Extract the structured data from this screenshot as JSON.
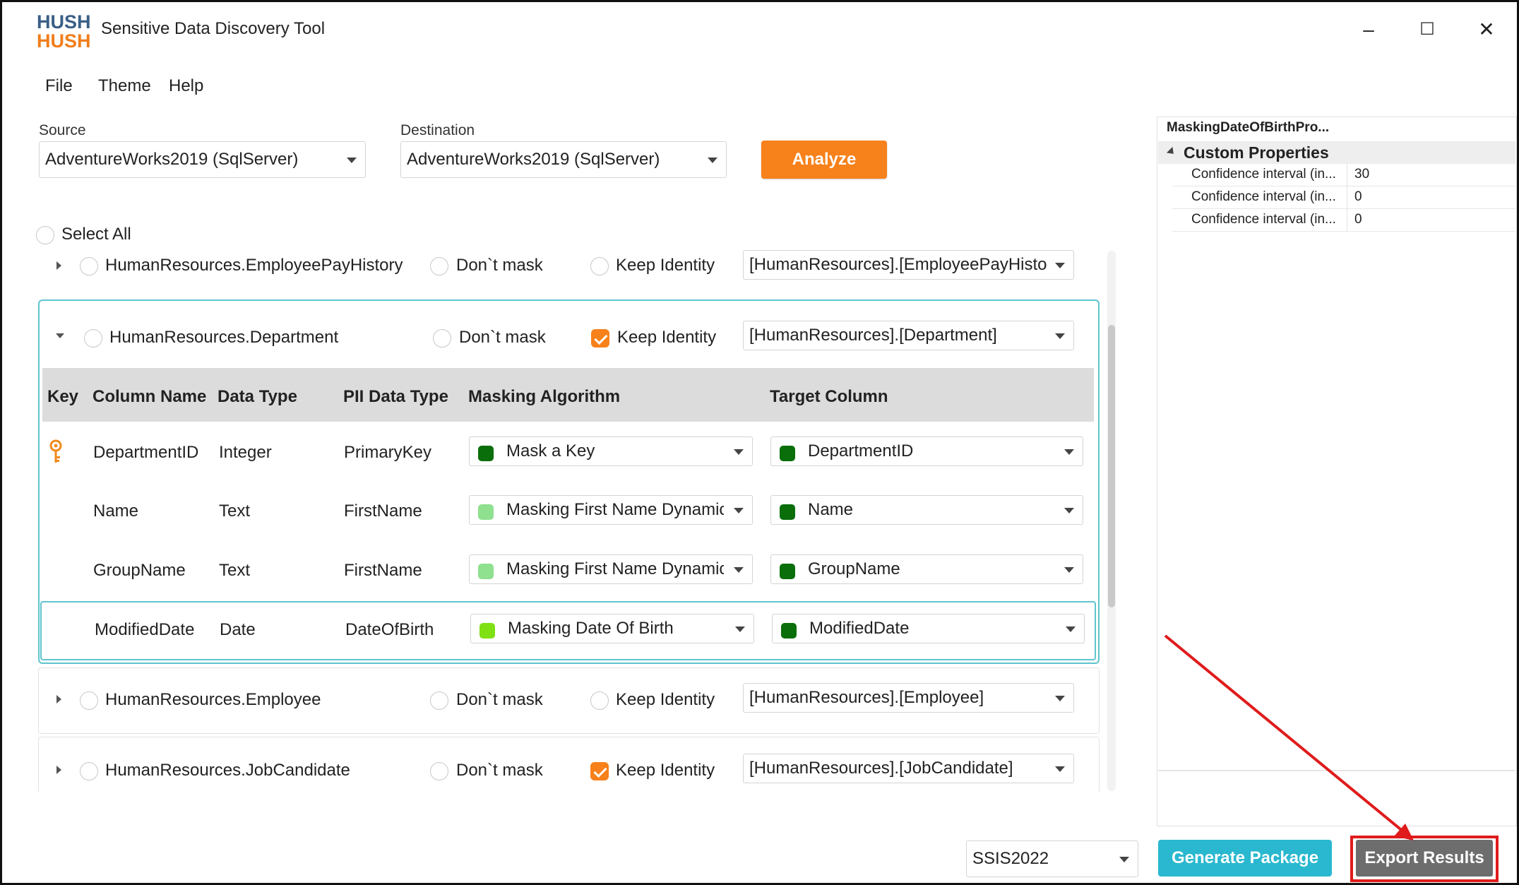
{
  "app": {
    "logo_line1": "HUSH",
    "logo_line2": "HUSH",
    "title": "Sensitive Data Discovery Tool",
    "minimize": "–",
    "maximize": "☐",
    "close": "✕"
  },
  "menu": [
    "File",
    "Theme",
    "Help"
  ],
  "source": {
    "label": "Source",
    "value": "AdventureWorks2019 (SqlServer)"
  },
  "destination": {
    "label": "Destination",
    "value": "AdventureWorks2019 (SqlServer)"
  },
  "analyze_label": "Analyze",
  "select_all_label": "Select All",
  "tables": [
    {
      "name": "HumanResources.EmployeePayHistory",
      "dont_mask": "Don`t mask",
      "keep_identity": "Keep Identity",
      "keep_identity_checked": false,
      "target": "[HumanResources].[EmployeePayHistory]"
    },
    {
      "name": "HumanResources.Department",
      "dont_mask": "Don`t mask",
      "keep_identity": "Keep Identity",
      "keep_identity_checked": true,
      "target": "[HumanResources].[Department]"
    },
    {
      "name": "HumanResources.Employee",
      "dont_mask": "Don`t mask",
      "keep_identity": "Keep Identity",
      "keep_identity_checked": false,
      "target": "[HumanResources].[Employee]"
    },
    {
      "name": "HumanResources.JobCandidate",
      "dont_mask": "Don`t mask",
      "keep_identity": "Keep Identity",
      "keep_identity_checked": true,
      "target": "[HumanResources].[JobCandidate]"
    }
  ],
  "grid": {
    "headers": [
      "Key",
      "Column Name",
      "Data Type",
      "PII Data Type",
      "Masking Algorithm",
      "Target Column"
    ],
    "rows": [
      {
        "key": true,
        "column": "DepartmentID",
        "type": "Integer",
        "pii": "PrimaryKey",
        "algorithm": "Mask a Key",
        "algorithm_color": "#0a6e0a",
        "target": "DepartmentID",
        "target_color": "#0a6e0a"
      },
      {
        "key": false,
        "column": "Name",
        "type": "Text",
        "pii": "FirstName",
        "algorithm": "Masking First Name Dynamic",
        "algorithm_color": "#8fe08f",
        "target": "Name",
        "target_color": "#0a6e0a"
      },
      {
        "key": false,
        "column": "GroupName",
        "type": "Text",
        "pii": "FirstName",
        "algorithm": "Masking First Name Dynamic",
        "algorithm_color": "#8fe08f",
        "target": "GroupName",
        "target_color": "#0a6e0a"
      },
      {
        "key": false,
        "column": "ModifiedDate",
        "type": "Date",
        "pii": "DateOfBirth",
        "algorithm": "Masking Date Of Birth",
        "algorithm_color": "#7fe014",
        "target": "ModifiedDate",
        "target_color": "#0a6e0a"
      }
    ]
  },
  "properties": {
    "title": "MaskingDateOfBirthPro...",
    "category": "Custom Properties",
    "items": [
      {
        "name": "Confidence interval (in...",
        "value": "30"
      },
      {
        "name": "Confidence interval (in...",
        "value": "0"
      },
      {
        "name": "Confidence interval (in...",
        "value": "0"
      }
    ]
  },
  "footer": {
    "ssis_version": "SSIS2022",
    "generate_label": "Generate Package",
    "export_label": "Export Results"
  },
  "colors": {
    "accent_orange": "#f7811a",
    "accent_teal": "#29b8cf",
    "annotation_red": "#e01b1b"
  }
}
